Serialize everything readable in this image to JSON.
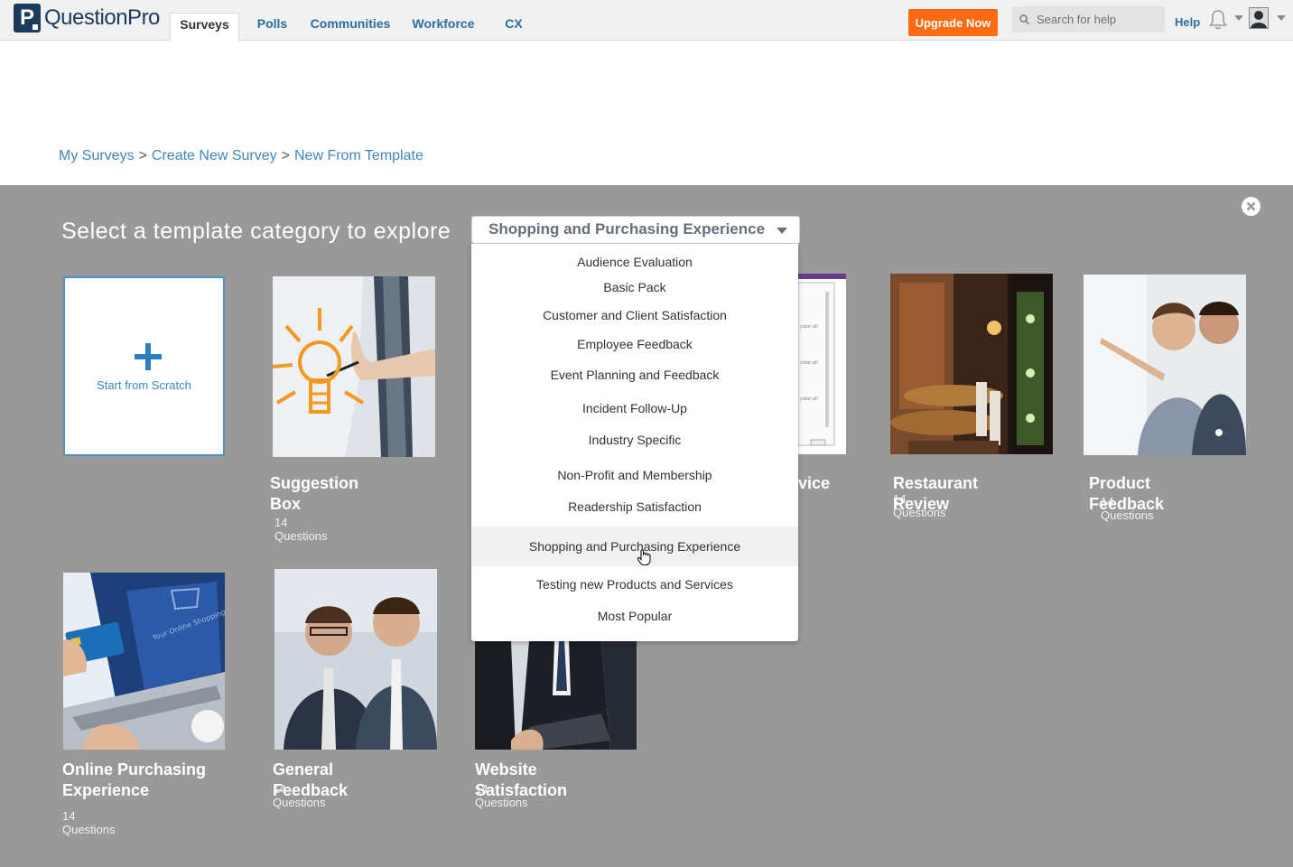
{
  "brand": {
    "logo_letter": "P",
    "logo_text": "QuestionPro",
    "accent": "#ff6a13",
    "link_color": "#3f86bd"
  },
  "nav": {
    "tabs": [
      "Surveys",
      "Polls",
      "Communities",
      "Workforce",
      "CX"
    ],
    "active": "Surveys"
  },
  "header": {
    "upgrade_label": "Upgrade Now",
    "search_placeholder": "Search for help",
    "help_label": "Help"
  },
  "breadcrumb": {
    "items": [
      "My Surveys",
      "Create New Survey",
      "New From Template"
    ],
    "separator": ">"
  },
  "panel": {
    "title": "Select a template category to explore",
    "selected_category": "Shopping and Purchasing Experience"
  },
  "dropdown": {
    "options": [
      "Audience Evaluation",
      "Basic Pack",
      "Customer and Client Satisfaction",
      "Employee Feedback",
      "Event Planning and Feedback",
      "Incident Follow-Up",
      "Industry Specific",
      "Non-Profit and Membership",
      "Readership Satisfaction",
      "Shopping and Purchasing Experience",
      "Testing new Products and Services",
      "Most Popular"
    ],
    "hovered": "Shopping and Purchasing Experience"
  },
  "templates": {
    "scratch_label": "Start from Scratch",
    "cards": [
      {
        "title": "Suggestion Box",
        "count": "14 Questions"
      },
      {
        "title": "vice",
        "count": ""
      },
      {
        "title": "Restaurant Review",
        "count": "14 Questions"
      },
      {
        "title": "Product Feedback",
        "count": "14 Questions"
      },
      {
        "title": "Online Purchasing Experience",
        "count": "14 Questions"
      },
      {
        "title": "General Feedback",
        "count": "14 Questions"
      },
      {
        "title": "Website Satisfaction",
        "count": "14 Questions"
      }
    ]
  }
}
